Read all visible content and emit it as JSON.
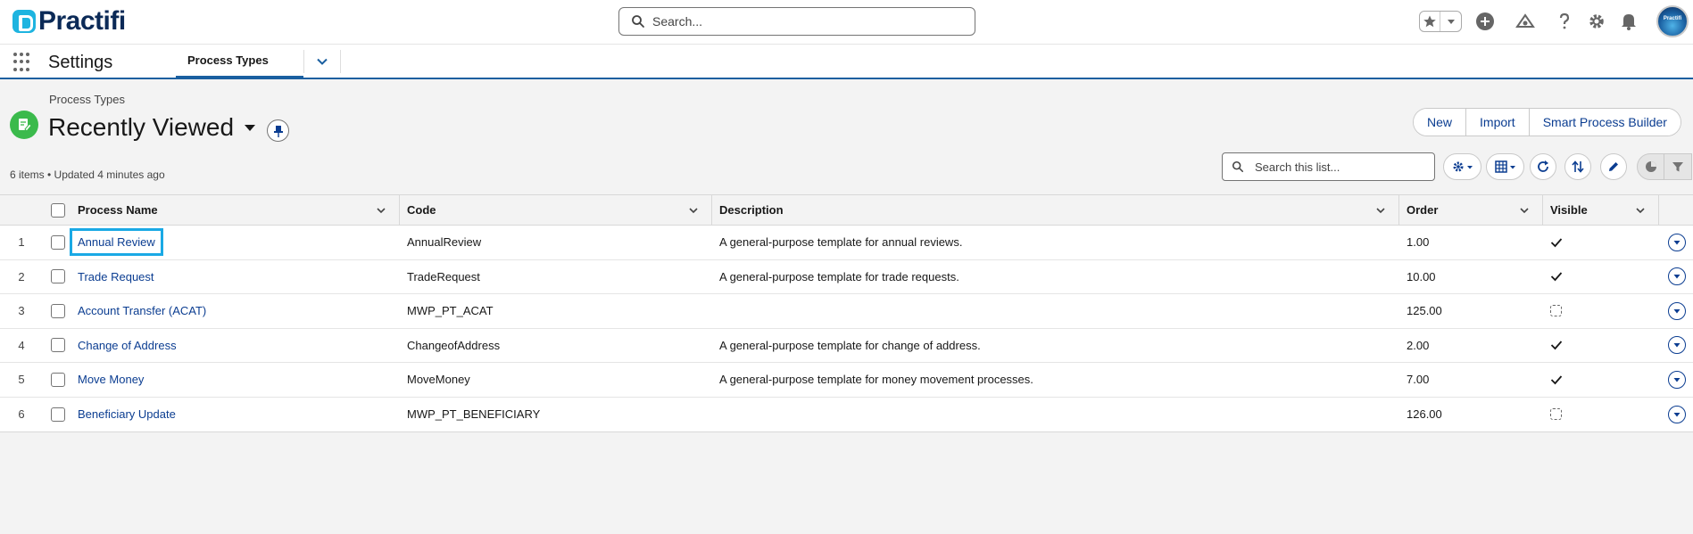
{
  "header": {
    "logo_text": "Practifi",
    "search_placeholder": "Search...",
    "avatar_text": "Practifi",
    "icons": [
      "star-icon",
      "chevron-down-icon",
      "add-icon",
      "trailhead-icon",
      "help-icon",
      "setup-gear-icon",
      "notification-bell-icon"
    ]
  },
  "nav": {
    "app_name": "Settings",
    "active_tab": "Process Types"
  },
  "list": {
    "object_label": "Process Types",
    "view_name": "Recently Viewed",
    "meta": "6 items • Updated 4 minutes ago",
    "buttons": [
      "New",
      "Import",
      "Smart Process Builder"
    ],
    "search_placeholder": "Search this list..."
  },
  "table": {
    "columns": [
      "Process Name",
      "Code",
      "Description",
      "Order",
      "Visible"
    ],
    "rows": [
      {
        "num": "1",
        "name": "Annual Review",
        "code": "AnnualReview",
        "description": "A general-purpose template for annual reviews.",
        "order": "1.00",
        "visible": true
      },
      {
        "num": "2",
        "name": "Trade Request",
        "code": "TradeRequest",
        "description": "A general-purpose template for trade requests.",
        "order": "10.00",
        "visible": true
      },
      {
        "num": "3",
        "name": "Account Transfer (ACAT)",
        "code": "MWP_PT_ACAT",
        "description": "",
        "order": "125.00",
        "visible": false
      },
      {
        "num": "4",
        "name": "Change of Address",
        "code": "ChangeofAddress",
        "description": "A general-purpose template for change of address.",
        "order": "2.00",
        "visible": true
      },
      {
        "num": "5",
        "name": "Move Money",
        "code": "MoveMoney",
        "description": "A general-purpose template for money movement processes.",
        "order": "7.00",
        "visible": true
      },
      {
        "num": "6",
        "name": "Beneficiary Update",
        "code": "MWP_PT_BENEFICIARY",
        "description": "",
        "order": "126.00",
        "visible": false
      }
    ]
  },
  "colors": {
    "brand_navy": "#0b2a57",
    "link_blue": "#0b3d91",
    "focus_highlight": "#1aa9e5",
    "object_icon_green": "#3bba4c"
  }
}
